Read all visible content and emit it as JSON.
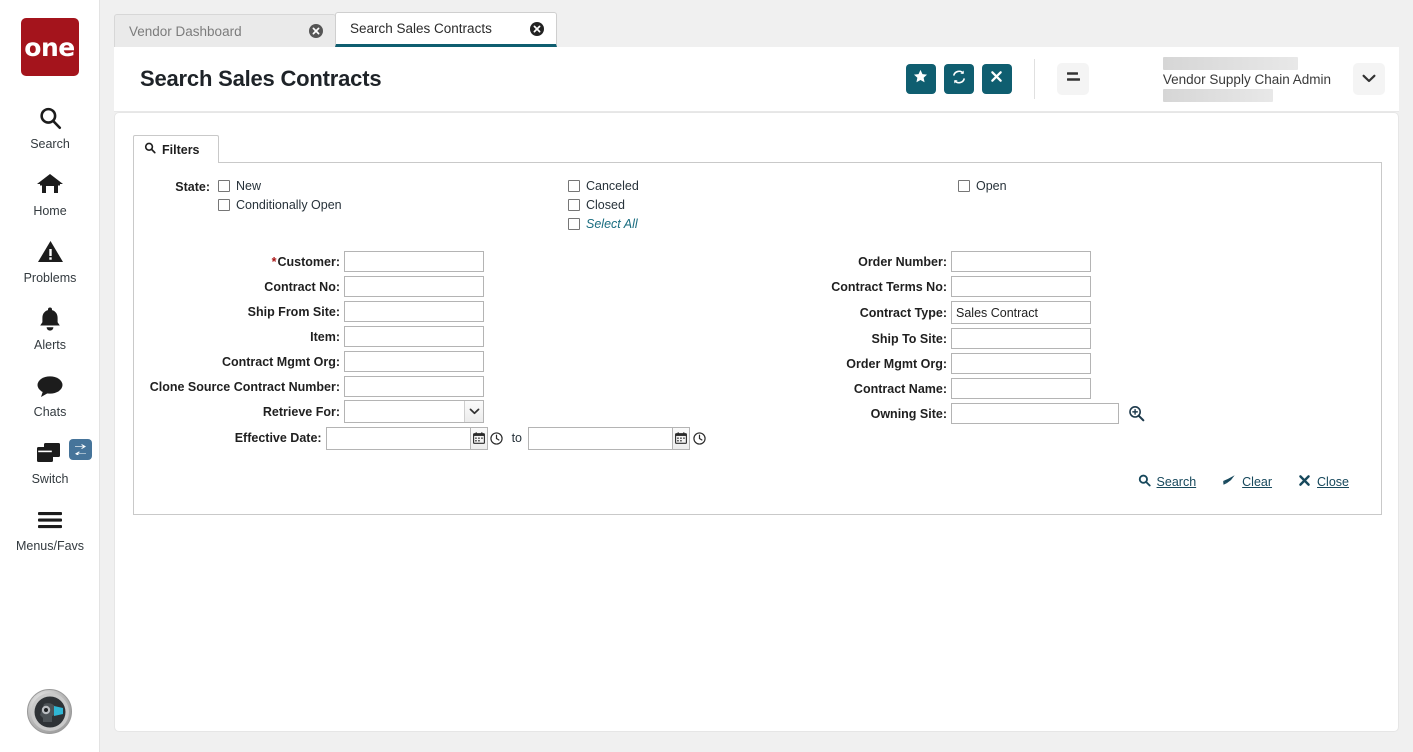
{
  "app": {
    "logo_text": "one",
    "brand_color": "#a4141c",
    "accent_color": "#0f5e70",
    "link_color": "#17485c"
  },
  "rail": {
    "items": [
      {
        "label": "Search",
        "icon": "search-icon"
      },
      {
        "label": "Home",
        "icon": "home-icon"
      },
      {
        "label": "Problems",
        "icon": "warning-triangle-icon"
      },
      {
        "label": "Alerts",
        "icon": "bell-icon"
      },
      {
        "label": "Chats",
        "icon": "chat-bubble-icon"
      },
      {
        "label": "Switch",
        "icon": "windows-stack-icon",
        "badge_icon": "swap-arrows-icon"
      },
      {
        "label": "Menus/Favs",
        "icon": "hamburger-icon"
      }
    ],
    "avatar_icon": "ai-assistant-avatar"
  },
  "tabs": [
    {
      "label": "Vendor Dashboard",
      "active": false,
      "close_icon": "close-circle-icon"
    },
    {
      "label": "Search Sales Contracts",
      "active": true,
      "close_icon": "close-circle-icon"
    }
  ],
  "header": {
    "title": "Search Sales Contracts",
    "buttons": [
      {
        "name": "favorite-button",
        "icon": "star-icon"
      },
      {
        "name": "refresh-button",
        "icon": "refresh-icon"
      },
      {
        "name": "close-button",
        "icon": "x-icon"
      }
    ],
    "menu_button_icon": "list-menu-icon",
    "user_role": "Vendor Supply Chain Admin",
    "user_caret_icon": "chevron-down-icon"
  },
  "filters": {
    "tab_label": "Filters",
    "tab_icon": "search-icon",
    "state": {
      "label": "State:",
      "column1": [
        {
          "label": "New",
          "checked": false
        },
        {
          "label": "Conditionally Open",
          "checked": false
        }
      ],
      "column2": [
        {
          "label": "Canceled",
          "checked": false
        },
        {
          "label": "Closed",
          "checked": false
        },
        {
          "label": "Select All",
          "checked": false,
          "style": "italic-link"
        }
      ],
      "column3": [
        {
          "label": "Open",
          "checked": false
        }
      ]
    },
    "left_fields": [
      {
        "label": "Customer:",
        "value": "",
        "required": true,
        "type": "text"
      },
      {
        "label": "Contract No:",
        "value": "",
        "required": false,
        "type": "text"
      },
      {
        "label": "Ship From Site:",
        "value": "",
        "required": false,
        "type": "text"
      },
      {
        "label": "Item:",
        "value": "",
        "required": false,
        "type": "text"
      },
      {
        "label": "Contract Mgmt Org:",
        "value": "",
        "required": false,
        "type": "text"
      },
      {
        "label": "Clone Source Contract Number:",
        "value": "",
        "required": false,
        "type": "text"
      },
      {
        "label": "Retrieve For:",
        "value": "",
        "required": false,
        "type": "select"
      },
      {
        "label": "Effective Date:",
        "value": "",
        "value_to": "",
        "required": false,
        "type": "daterange",
        "range_separator": "to"
      }
    ],
    "right_fields": [
      {
        "label": "Order Number:",
        "value": "",
        "type": "text"
      },
      {
        "label": "Contract Terms No:",
        "value": "",
        "type": "text"
      },
      {
        "label": "Contract Type:",
        "value": "Sales Contract",
        "type": "text"
      },
      {
        "label": "Ship To Site:",
        "value": "",
        "type": "text"
      },
      {
        "label": "Order Mgmt Org:",
        "value": "",
        "type": "text"
      },
      {
        "label": "Contract Name:",
        "value": "",
        "type": "text"
      },
      {
        "label": "Owning Site:",
        "value": "",
        "type": "text-lookup",
        "lookup_icon": "magnifier-plus-icon"
      }
    ],
    "actions": [
      {
        "label": "Search",
        "icon": "search-icon"
      },
      {
        "label": "Clear",
        "icon": "eraser-icon"
      },
      {
        "label": "Close",
        "icon": "x-icon"
      }
    ]
  }
}
